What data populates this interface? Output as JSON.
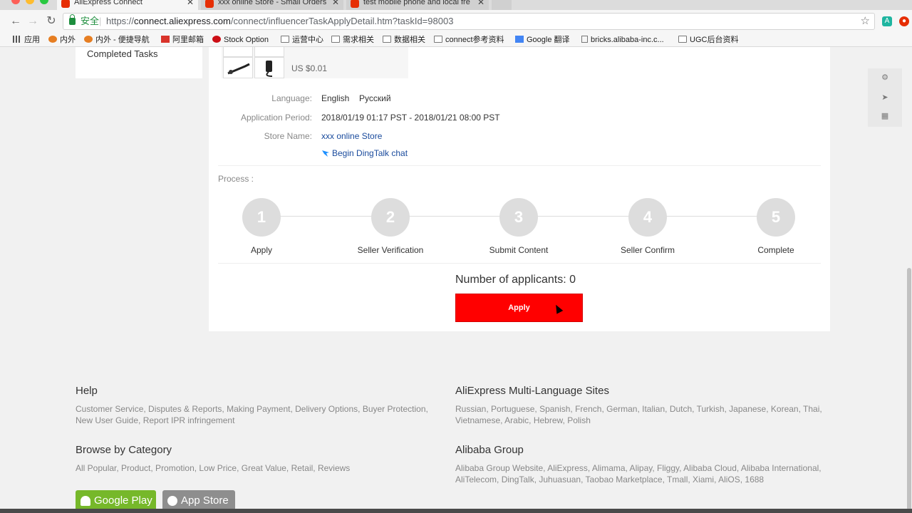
{
  "browser": {
    "tabs": [
      {
        "title": "AliExpress Connect",
        "active": true
      },
      {
        "title": "xxx online Store - Small Orders",
        "active": false
      },
      {
        "title": "test mobile phone and local fre",
        "active": false
      }
    ],
    "secure_label": "安全",
    "url_scheme": "https://",
    "url_host": "connect.aliexpress.com",
    "url_path": "/connect/influencerTaskApplyDetail.htm?taskId=98003",
    "bookmarks": [
      "应用",
      "内外",
      "内外 - 便捷导航",
      "阿里邮箱",
      "Stock Option",
      "运营中心",
      "需求相关",
      "数据相关",
      "connect参考资料",
      "Google 翻译",
      "bricks.alibaba-inc.c...",
      "UGC后台资料"
    ]
  },
  "sidebar": {
    "completed_tasks": "Completed Tasks"
  },
  "task": {
    "price": "US $0.01",
    "language_label": "Language:",
    "languages": [
      "English",
      "Русский"
    ],
    "period_label": "Application Period:",
    "period": "2018/01/19 01:17 PST - 2018/01/21 08:00 PST",
    "store_label": "Store Name:",
    "store_name": "xxx online Store",
    "dingtalk": "Begin DingTalk chat"
  },
  "process": {
    "label": "Process :",
    "steps": [
      {
        "number": "1",
        "label": "Apply"
      },
      {
        "number": "2",
        "label": "Seller Verification"
      },
      {
        "number": "3",
        "label": "Submit Content"
      },
      {
        "number": "4",
        "label": "Seller Confirm"
      },
      {
        "number": "5",
        "label": "Complete"
      }
    ]
  },
  "apply": {
    "applicants_text": "Number of applicants: 0",
    "button_label": "Apply"
  },
  "footer": {
    "help": {
      "title": "Help",
      "links": "Customer Service, Disputes & Reports, Making Payment, Delivery Options, Buyer Protection, New User Guide, Report IPR infringement"
    },
    "multilang": {
      "title": "AliExpress Multi-Language Sites",
      "links": "Russian, Portuguese, Spanish, French, German, Italian, Dutch, Turkish, Japanese, Korean, Thai, Vietnamese, Arabic, Hebrew, Polish"
    },
    "category": {
      "title": "Browse by Category",
      "links": "All Popular, Product, Promotion, Low Price, Great Value, Retail, Reviews"
    },
    "alibaba": {
      "title": "Alibaba Group",
      "links": "Alibaba Group Website, AliExpress, Alimama, Alipay, Fliggy, Alibaba Cloud, Alibaba International, AliTelecom, DingTalk, Juhuasuan, Taobao Marketplace, Tmall, Xiami, AliOS, 1688"
    },
    "google_play": "Google Play",
    "app_store": "App Store"
  },
  "colors": {
    "accent": "#ff0000",
    "link": "#1a4b9d",
    "step": "#dddddd",
    "google_play": "#76b82a",
    "app_store": "#8e8e8e"
  }
}
